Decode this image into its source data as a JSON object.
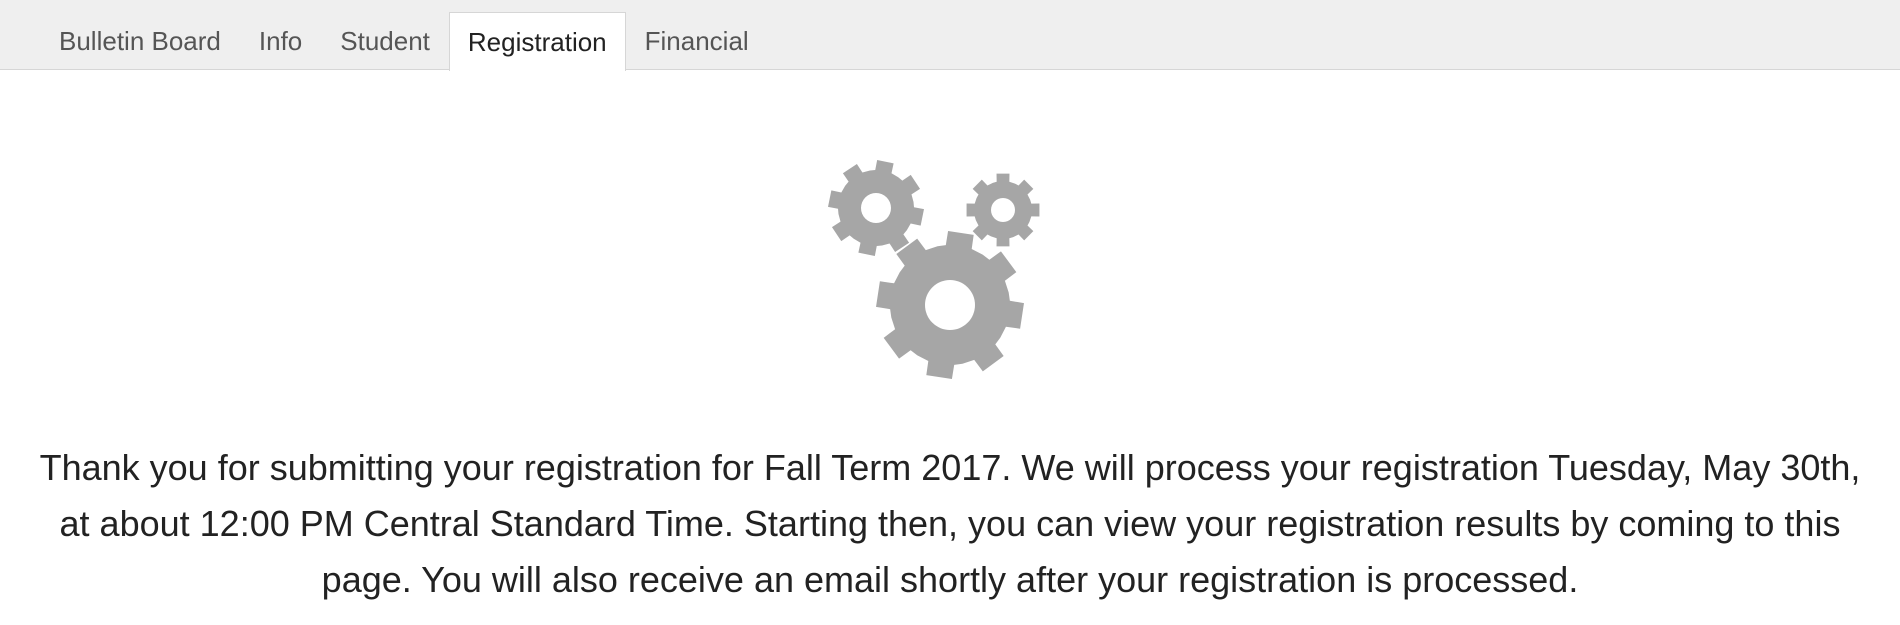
{
  "tabs": [
    {
      "label": "Bulletin Board",
      "active": false
    },
    {
      "label": "Info",
      "active": false
    },
    {
      "label": "Student",
      "active": false
    },
    {
      "label": "Registration",
      "active": true
    },
    {
      "label": "Financial",
      "active": false
    }
  ],
  "status": {
    "icon": "gears-icon",
    "icon_color": "#a6a6a6",
    "message": "Thank you for submitting your registration for Fall Term 2017. We will process your registration Tuesday, May 30th, at about 12:00 PM Central Standard Time. Starting then, you can view your registration results by coming to this page. You will also receive an email shortly after your registration is processed."
  }
}
